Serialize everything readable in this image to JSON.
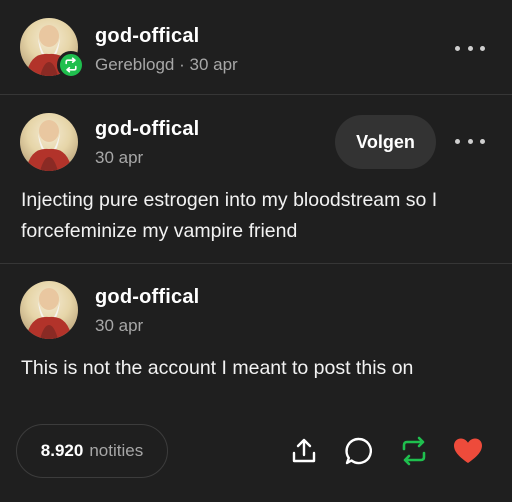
{
  "post": {
    "reblogger": {
      "username": "god-offical",
      "meta": "Gereblogd · 30 apr"
    },
    "author": {
      "username": "god-offical",
      "date": "30 apr",
      "follow_label": "Volgen",
      "text": "Injecting pure estrogen into my bloodstream so I forcefeminize my vampire friend"
    },
    "reply": {
      "username": "god-offical",
      "date": "30 apr",
      "text": "This is not the account I meant to post this on"
    }
  },
  "footer": {
    "notes_count": "8.920",
    "notes_label": "notities",
    "actions": [
      "share-icon",
      "reply-icon",
      "reblog-icon",
      "like-icon"
    ]
  },
  "colors": {
    "background": "#1f1f1f",
    "reblog_green": "#1fbf4e",
    "like_red": "#ee4b3b",
    "muted_text": "#a7a7a7"
  }
}
